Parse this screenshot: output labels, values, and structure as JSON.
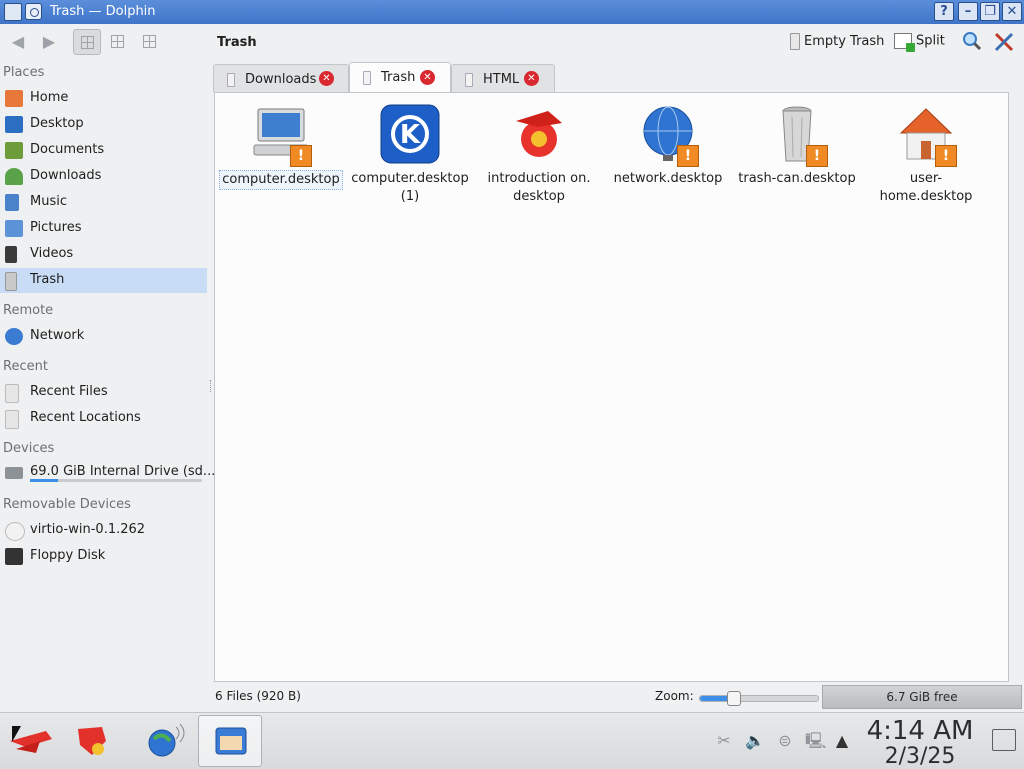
{
  "window": {
    "title": "Trash — Dolphin"
  },
  "titlebar_buttons": [
    "?",
    "–",
    "❐",
    "✕"
  ],
  "toolbar": {
    "location": "Trash",
    "empty_trash": "Empty Trash",
    "split": "Split"
  },
  "sidebar": {
    "places_label": "Places",
    "places": [
      "Home",
      "Desktop",
      "Documents",
      "Downloads",
      "Music",
      "Pictures",
      "Videos",
      "Trash"
    ],
    "remote_label": "Remote",
    "remote": [
      "Network"
    ],
    "recent_label": "Recent",
    "recent": [
      "Recent Files",
      "Recent Locations"
    ],
    "devices_label": "Devices",
    "devices": [
      "69.0 GiB Internal Drive (sd..."
    ],
    "device_usage_fraction": 0.16,
    "removable_label": "Removable Devices",
    "removable": [
      "virtio-win-0.1.262",
      "Floppy Disk"
    ]
  },
  "tabs": [
    "Downloads",
    "Trash",
    "HTML"
  ],
  "files": [
    {
      "name": "computer.desktop",
      "icon": "computer-icon"
    },
    {
      "name": "computer.desktop (1)",
      "icon": "kde-icon"
    },
    {
      "name": "introduction on. desktop",
      "icon": "konqi-icon"
    },
    {
      "name": "network.desktop",
      "icon": "network-globe-icon"
    },
    {
      "name": "trash-can.desktop",
      "icon": "trash-can-icon"
    },
    {
      "name": "user-home.desktop",
      "icon": "user-home-icon"
    }
  ],
  "status": {
    "info": "6 Files (920 B)",
    "zoom_label": "Zoom:",
    "zoom_fraction": 0.28,
    "free_space": "6.7 GiB free"
  },
  "taskbar": {
    "time": "4:14 AM",
    "date": "2/3/25"
  },
  "colors": {
    "titlebar": "#3f74c8",
    "selection": "#c9dcf5",
    "accent": "#3d8ee6",
    "warning": "#f08a24"
  }
}
